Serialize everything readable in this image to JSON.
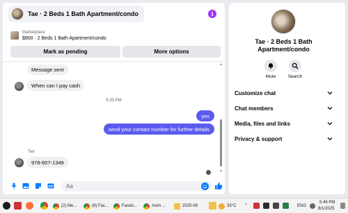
{
  "chat": {
    "title": "Tae · 2 Beds 1 Bath Apartment/condo",
    "marketplace_label": "Marketplace",
    "listing": "$900 · 2 Beds 1 Bath Apartment/condo",
    "mark_pending_label": "Mark as pending",
    "more_options_label": "More options",
    "messages": [
      {
        "text": "Message sent"
      },
      {
        "text": "When can I pay cash"
      },
      {
        "text": "5:33 PM"
      },
      {
        "text": "yes"
      },
      {
        "text": "send your contact number for further details"
      },
      {
        "text": "Tae"
      },
      {
        "text": "978-607-1349"
      }
    ],
    "composer_placeholder": "Aa"
  },
  "info": {
    "title": "Tae · 2 Beds 1 Bath Apartment/condo",
    "mute_label": "Mute",
    "search_label": "Search",
    "sections": [
      "Customize chat",
      "Chat members",
      "Media, files and links",
      "Privacy & support"
    ]
  },
  "taskbar": {
    "items": [
      "(2) Me...",
      "(8) Fac...",
      "Faceb...",
      "Asim ...",
      "2025-08"
    ],
    "weather": "33°C",
    "language": "ENG",
    "time": "5:46 PM",
    "date": "8/1/2025"
  },
  "colors": {
    "accent": "#5b5bf0",
    "messenger_blue": "#0a7cff",
    "info_purple": "#a033ff"
  }
}
